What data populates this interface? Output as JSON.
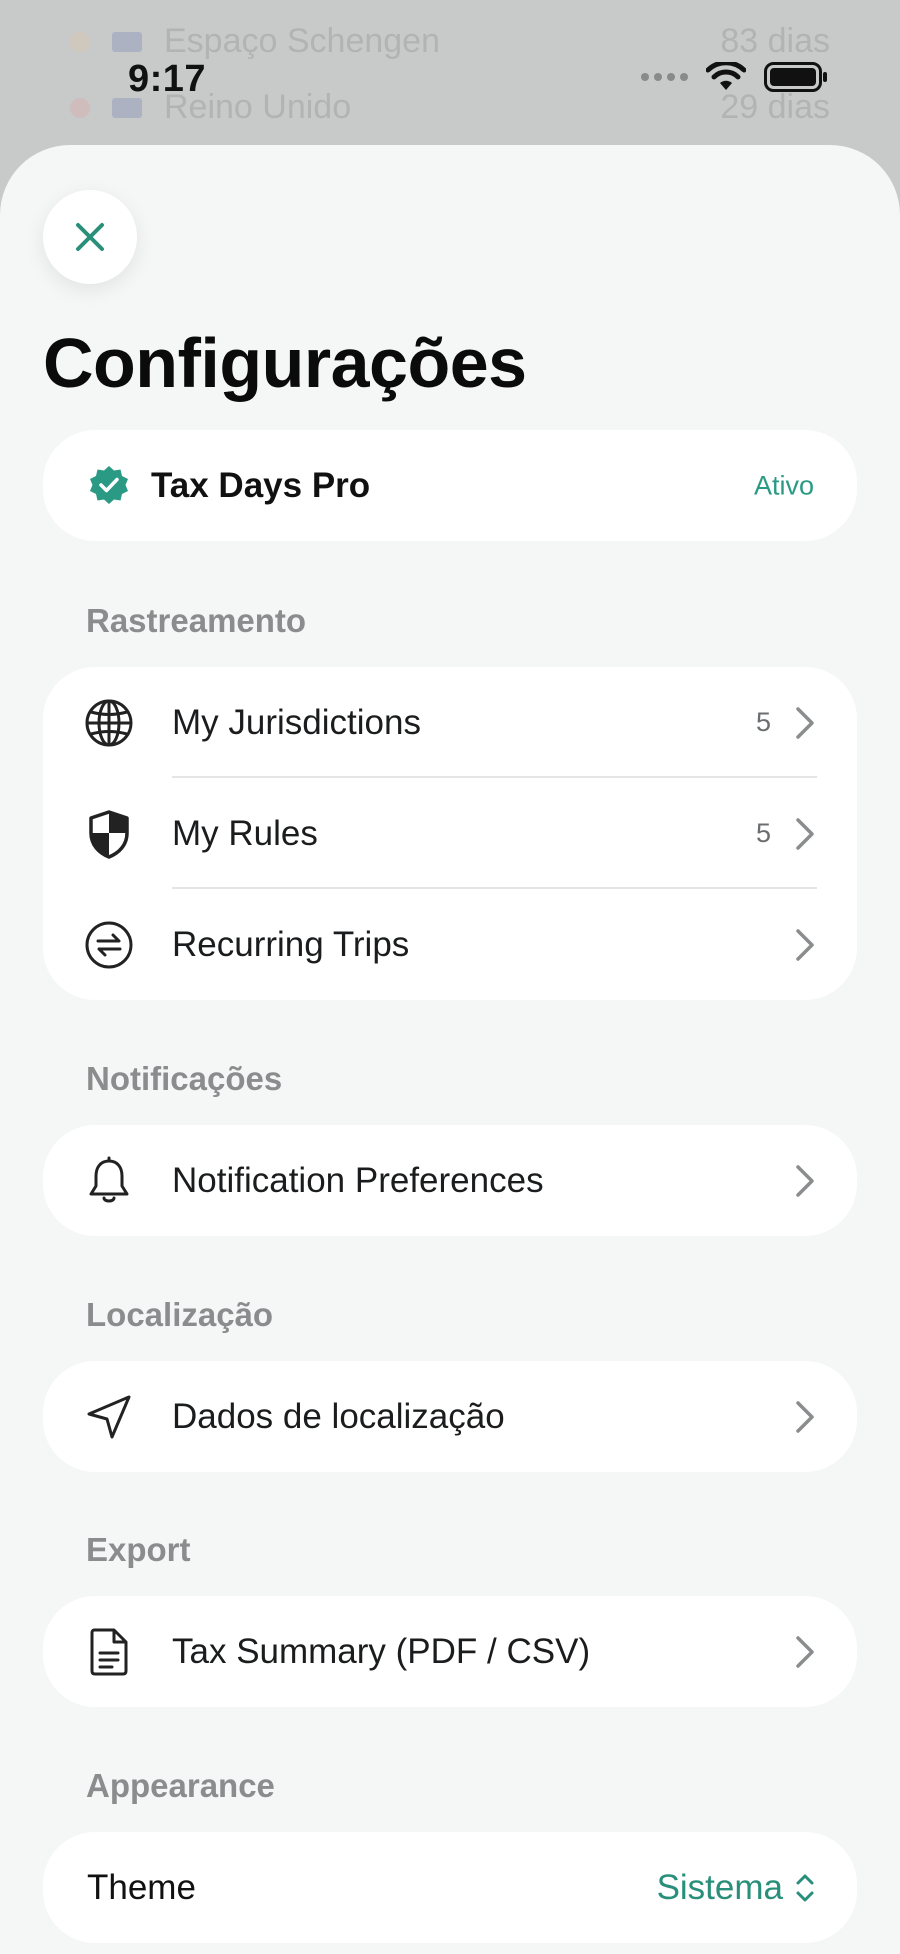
{
  "status_bar": {
    "time": "9:17"
  },
  "background_rows": [
    {
      "name": "Espaço Schengen",
      "days": "83 dias",
      "dot_color": "#f5c08a"
    },
    {
      "name": "Reino Unido",
      "days": "29 dias",
      "dot_color": "#f08a8a"
    }
  ],
  "header": {
    "title": "Configurações"
  },
  "subscription": {
    "name": "Tax Days Pro",
    "status": "Ativo"
  },
  "sections": {
    "tracking": {
      "header": "Rastreamento",
      "items": [
        {
          "label": "My Jurisdictions",
          "count": "5",
          "icon": "globe-icon"
        },
        {
          "label": "My Rules",
          "count": "5",
          "icon": "shield-icon"
        },
        {
          "label": "Recurring Trips",
          "icon": "repeat-icon"
        }
      ]
    },
    "notifications": {
      "header": "Notificações",
      "items": [
        {
          "label": "Notification Preferences",
          "icon": "bell-icon"
        }
      ]
    },
    "location": {
      "header": "Localização",
      "items": [
        {
          "label": "Dados de localização",
          "icon": "location-arrow-icon"
        }
      ]
    },
    "export": {
      "header": "Export",
      "items": [
        {
          "label": "Tax Summary (PDF / CSV)",
          "icon": "document-icon"
        }
      ]
    },
    "appearance": {
      "header": "Appearance",
      "theme_label": "Theme",
      "theme_value": "Sistema"
    }
  },
  "colors": {
    "accent": "#2a9a84",
    "sheet_bg": "#f5f6f6",
    "card_bg": "#ffffff"
  }
}
